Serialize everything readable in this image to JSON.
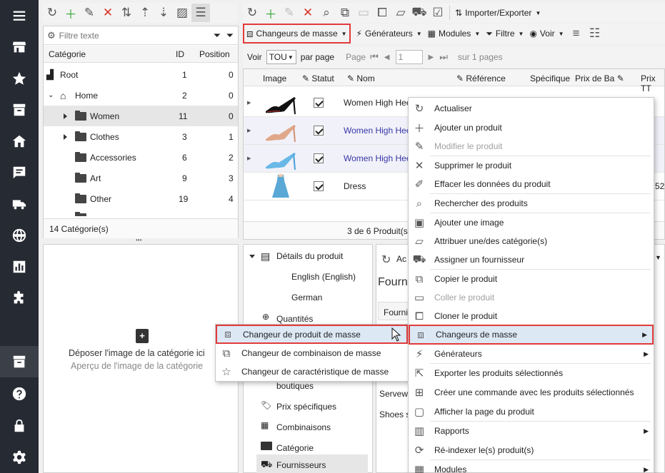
{
  "category_panel": {
    "filter_placeholder": "Filtre texte",
    "columns": {
      "category": "Catégorie",
      "id": "ID",
      "position": "Position"
    },
    "rows": [
      {
        "name": "Root",
        "id": "1",
        "position": "0"
      },
      {
        "name": "Home",
        "id": "2",
        "position": "0"
      },
      {
        "name": "Women",
        "id": "11",
        "position": "0"
      },
      {
        "name": "Clothes",
        "id": "3",
        "position": "1"
      },
      {
        "name": "Accessories",
        "id": "6",
        "position": "2"
      },
      {
        "name": "Art",
        "id": "9",
        "position": "3"
      },
      {
        "name": "Other",
        "id": "19",
        "position": "4"
      }
    ],
    "footer": "14 Catégorie(s)"
  },
  "image_drop": {
    "title": "Déposer l'image de la catégorie ici",
    "subtitle": "Aperçu de l'image de la catégorie"
  },
  "toolbar": {
    "import_export": "Importer/Exporter",
    "mass_changers": "Changeurs de masse",
    "generators": "Générateurs",
    "modules": "Modules",
    "filter": "Filtre",
    "view": "Voir"
  },
  "pager": {
    "show_label": "Voir",
    "show_value": "TOU",
    "per_page": "par page",
    "page_label": "Page",
    "page_value": "1",
    "of_pages": "sur 1 pages"
  },
  "product_grid": {
    "columns": {
      "image": "Image",
      "status": "Statut",
      "name": "Nom",
      "reference": "Référence",
      "specific": "Spécifique",
      "base_price": "Prix de Ba",
      "price_ttc": "Prix TT"
    },
    "rows": [
      {
        "name": "Women High Hee",
        "price_fragment": ""
      },
      {
        "name": "Women High Hee",
        "price_fragment": ""
      },
      {
        "name": "Women High Hee",
        "price_fragment": ""
      },
      {
        "name": "Dress",
        "price_fragment": "52"
      }
    ],
    "footer": "3 de 6 Produit(s)"
  },
  "detail_tree": {
    "items": [
      {
        "label": "Détails du produit"
      },
      {
        "label": "English (English)"
      },
      {
        "label": "German"
      },
      {
        "label": "Quantités"
      },
      {
        "label": "boutiques"
      },
      {
        "label": "Prix spécifiques"
      },
      {
        "label": "Combinaisons"
      },
      {
        "label": "Catégorie"
      },
      {
        "label": "Fournisseurs"
      }
    ]
  },
  "detail_pane": {
    "action_fragment": "Ac",
    "title_fragment": "Fourn",
    "col_fragment": "Fourni",
    "row1": "Servewa",
    "row2": "Shoes s"
  },
  "context_menu": {
    "items": [
      {
        "label": "Actualiser",
        "icon": "refresh-icon"
      },
      {
        "label": "Ajouter un produit",
        "icon": "plus-icon"
      },
      {
        "label": "Modifier le produit",
        "icon": "pencil-icon"
      },
      {
        "label": "Supprimer le produit",
        "icon": "x-icon"
      },
      {
        "label": "Effacer les données du produit",
        "icon": "eraser-icon"
      },
      {
        "label": "Rechercher des produits",
        "icon": "search-icon"
      },
      {
        "label": "Ajouter une image",
        "icon": "add-image-icon"
      },
      {
        "label": "Attribuer une/des catégorie(s)",
        "icon": "folder-check-icon"
      },
      {
        "label": "Assigner un fournisseur",
        "icon": "truck-check-icon"
      },
      {
        "label": "Copier le produit",
        "icon": "copy-icon"
      },
      {
        "label": "Coller le produit",
        "icon": "paste-icon"
      },
      {
        "label": "Cloner le produit",
        "icon": "clone-icon"
      },
      {
        "label": "Changeurs de masse",
        "icon": "mass-changer-icon"
      },
      {
        "label": "Générateurs",
        "icon": "lightning-icon"
      },
      {
        "label": "Exporter les produits sélectionnés",
        "icon": "export-icon"
      },
      {
        "label": "Créer une commande avec les produits sélectionnés",
        "icon": "create-order-icon"
      },
      {
        "label": "Afficher la page du produit",
        "icon": "page-icon"
      },
      {
        "label": "Rapports",
        "icon": "reports-icon"
      },
      {
        "label": "Ré-indexer le(s) produit(s)",
        "icon": "reindex-icon"
      },
      {
        "label": "Modules",
        "icon": "modules-icon"
      }
    ]
  },
  "submenu": {
    "items": [
      {
        "label": "Changeur de produit de masse",
        "icon": "product-mass-icon"
      },
      {
        "label": "Changeur de combinaison de masse",
        "icon": "combination-mass-icon"
      },
      {
        "label": "Changeur de caractéristique de masse",
        "icon": "feature-mass-icon"
      }
    ]
  },
  "colors": {
    "highlight_border": "#e23b3b",
    "sidebar_bg": "#262a33",
    "link_blue": "#3636a8",
    "hover_blue": "#dde8f5"
  }
}
